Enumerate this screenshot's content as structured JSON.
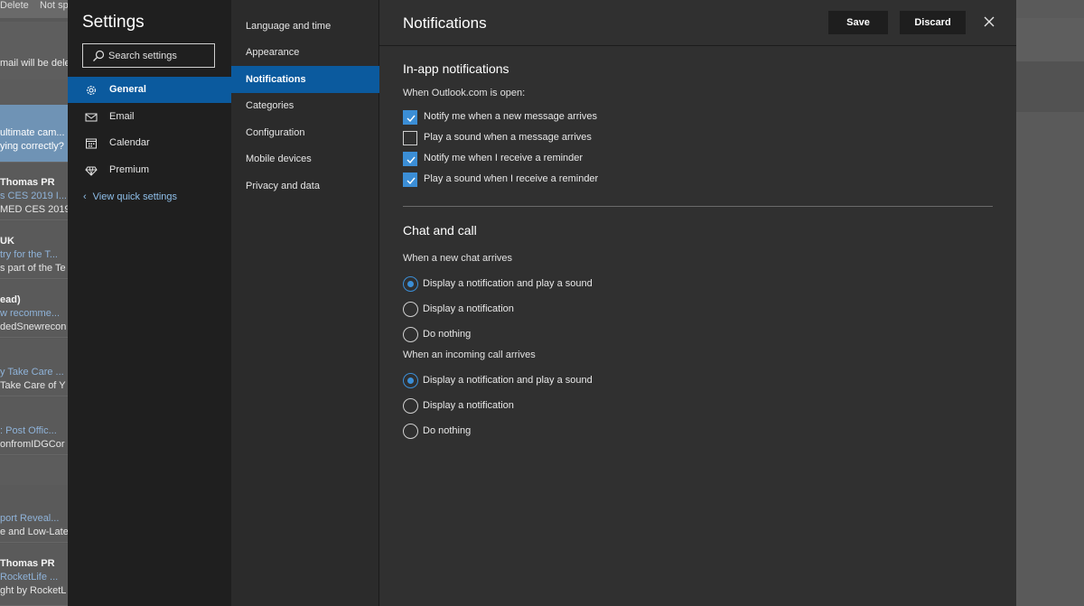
{
  "background": {
    "toolbar": {
      "delete_label": "Delete",
      "not_spam_label": "Not sp"
    },
    "notice_text": "mail will be dele",
    "messages": [
      {
        "line1": "ultimate cam...",
        "line2": "ying correctly?",
        "line3": "",
        "selected": true
      },
      {
        "line1": "Thomas PR",
        "line2": "s CES 2019 I...",
        "line3": "MED CES 2019",
        "selected": false
      },
      {
        "line1": "UK",
        "line2": "try for the T...",
        "line3": "s part of the Te",
        "selected": false
      },
      {
        "line1": "ead)",
        "line2": "w recomme...",
        "line3": "dedSnewrecon",
        "selected": false
      },
      {
        "line1": "",
        "line2": "y Take Care ...",
        "line3": "Take Care of Y",
        "selected": false
      },
      {
        "line1": "",
        "line2": ": Post Offic...",
        "line3": "onfromIDGCor",
        "selected": false
      },
      {
        "line1": "",
        "line2": "port Reveal...",
        "line3": "e and Low-Late",
        "selected": false
      },
      {
        "line1": "Thomas PR",
        "line2": "RocketLife ...",
        "line3": "ght by RocketL",
        "selected": false
      }
    ]
  },
  "settings": {
    "title": "Settings",
    "search": {
      "placeholder": "Search settings"
    },
    "categories": [
      {
        "label": "General",
        "icon": "gear-icon",
        "active": true
      },
      {
        "label": "Email",
        "icon": "mail-icon",
        "active": false
      },
      {
        "label": "Calendar",
        "icon": "calendar-icon",
        "active": false
      },
      {
        "label": "Premium",
        "icon": "diamond-icon",
        "active": false
      }
    ],
    "quick_settings_label": "View quick settings",
    "subcategories": [
      {
        "label": "Language and time",
        "active": false
      },
      {
        "label": "Appearance",
        "active": false
      },
      {
        "label": "Notifications",
        "active": true
      },
      {
        "label": "Categories",
        "active": false
      },
      {
        "label": "Configuration",
        "active": false
      },
      {
        "label": "Mobile devices",
        "active": false
      },
      {
        "label": "Privacy and data",
        "active": false
      }
    ]
  },
  "page": {
    "title": "Notifications",
    "save_label": "Save",
    "discard_label": "Discard",
    "in_app": {
      "heading": "In-app notifications",
      "subheading": "When Outlook.com is open:",
      "options": [
        {
          "label": "Notify me when a new message arrives",
          "checked": true
        },
        {
          "label": "Play a sound when a message arrives",
          "checked": false
        },
        {
          "label": "Notify me when I receive a reminder",
          "checked": true
        },
        {
          "label": "Play a sound when I receive a reminder",
          "checked": true
        }
      ]
    },
    "chat_call": {
      "heading": "Chat and call",
      "chat_group_label": "When a new chat arrives",
      "chat_options": [
        {
          "label": "Display a notification and play a sound",
          "selected": true
        },
        {
          "label": "Display a notification",
          "selected": false
        },
        {
          "label": "Do nothing",
          "selected": false
        }
      ],
      "call_group_label": "When an incoming call arrives",
      "call_options": [
        {
          "label": "Display a notification and play a sound",
          "selected": true
        },
        {
          "label": "Display a notification",
          "selected": false
        },
        {
          "label": "Do nothing",
          "selected": false
        }
      ]
    }
  },
  "colors": {
    "accent": "#0b5a9e",
    "check_fill": "#3b8ed6",
    "panel_dark": "#1f1f1f",
    "panel_mid": "#2b2b2b",
    "panel_content": "#303030"
  }
}
